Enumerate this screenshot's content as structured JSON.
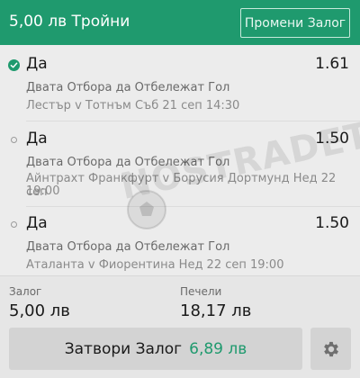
{
  "header": {
    "title": "5,00 лв Тройни",
    "change_bet_label": "Промени Залог"
  },
  "selections": [
    {
      "name": "Да",
      "odds": "1.61",
      "market": "Двата Отбора да Отбележат Гол",
      "event": "Лестър v Тотнъм Съб 21 сеп 14:30",
      "status": "won"
    },
    {
      "name": "Да",
      "odds": "1.50",
      "market": "Двата Отбора да Отбележат Гол",
      "event_line1": "Айнтрахт Франкфурт v Борусия Дортмунд Нед 22 сеп",
      "event_line2": "19:00",
      "status": "pending"
    },
    {
      "name": "Да",
      "odds": "1.50",
      "market": "Двата Отбора да Отбележат Гол",
      "event": "Аталанта v Фиорентина Нед 22 сеп 19:00",
      "status": "pending"
    }
  ],
  "watermark": {
    "text": "NOSTRADET"
  },
  "footer": {
    "stake_label": "Залог",
    "stake_value": "5,00 лв",
    "returns_label": "Печели",
    "returns_value": "18,17 лв",
    "cashout_label": "Затвори Залог",
    "cashout_amount": "6,89 лв"
  },
  "colors": {
    "accent": "#1f9a6e",
    "background": "#ececec",
    "button": "#d3d3d3"
  },
  "icons": {
    "won_status": "check-circle-icon",
    "pending_status": "circle-outline-icon",
    "settings": "gear-icon"
  }
}
